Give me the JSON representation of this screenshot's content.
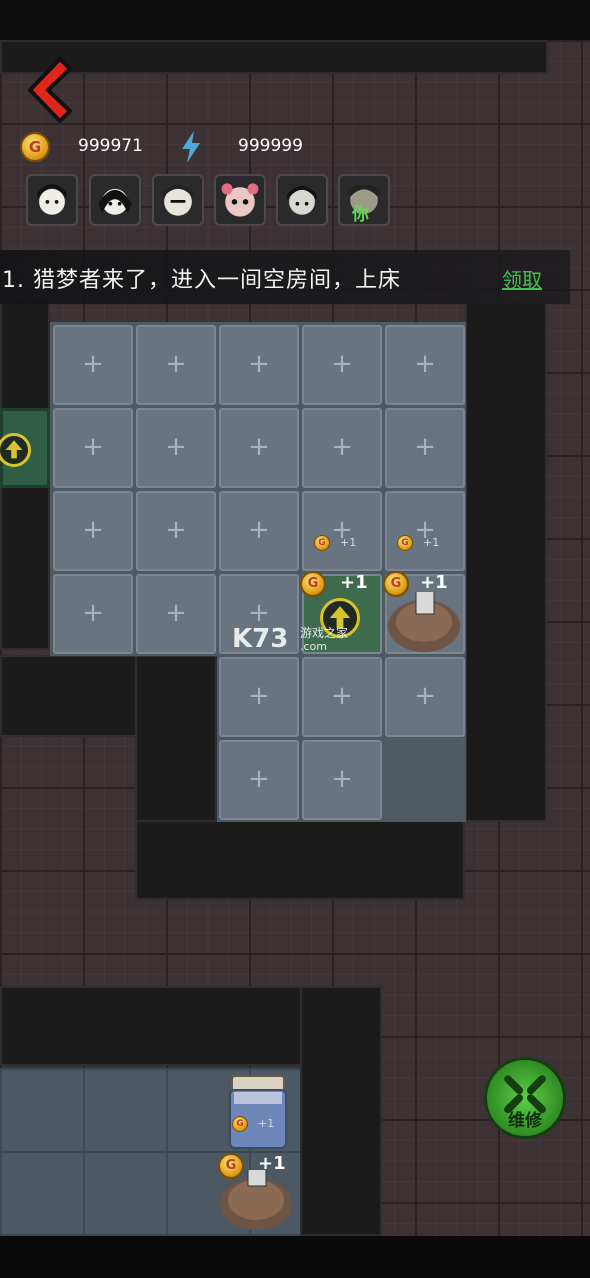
{
  "hud": {
    "coin_symbol": "G",
    "coins": "999971",
    "energy": "999999"
  },
  "characters": [
    {
      "name": "character-1"
    },
    {
      "name": "character-2"
    },
    {
      "name": "character-3"
    },
    {
      "name": "character-4"
    },
    {
      "name": "character-5"
    },
    {
      "name": "character-6",
      "tag": "你"
    }
  ],
  "quest": {
    "text": "1. 猎梦者来了，进入一间空房间，上床",
    "claim_label": "领取"
  },
  "room": {
    "tile_plus": "+",
    "income_labels": [
      "+1",
      "+1",
      "+1",
      "+1",
      "+1",
      "+1"
    ]
  },
  "watermark": {
    "brand": "K73",
    "sub": "游戏之家",
    "domain": ".com"
  },
  "repair": {
    "label": "维修"
  },
  "colors": {
    "accent_green": "#43c04f",
    "back_red": "#e0251b",
    "coin_gold": "#e0a21c"
  }
}
